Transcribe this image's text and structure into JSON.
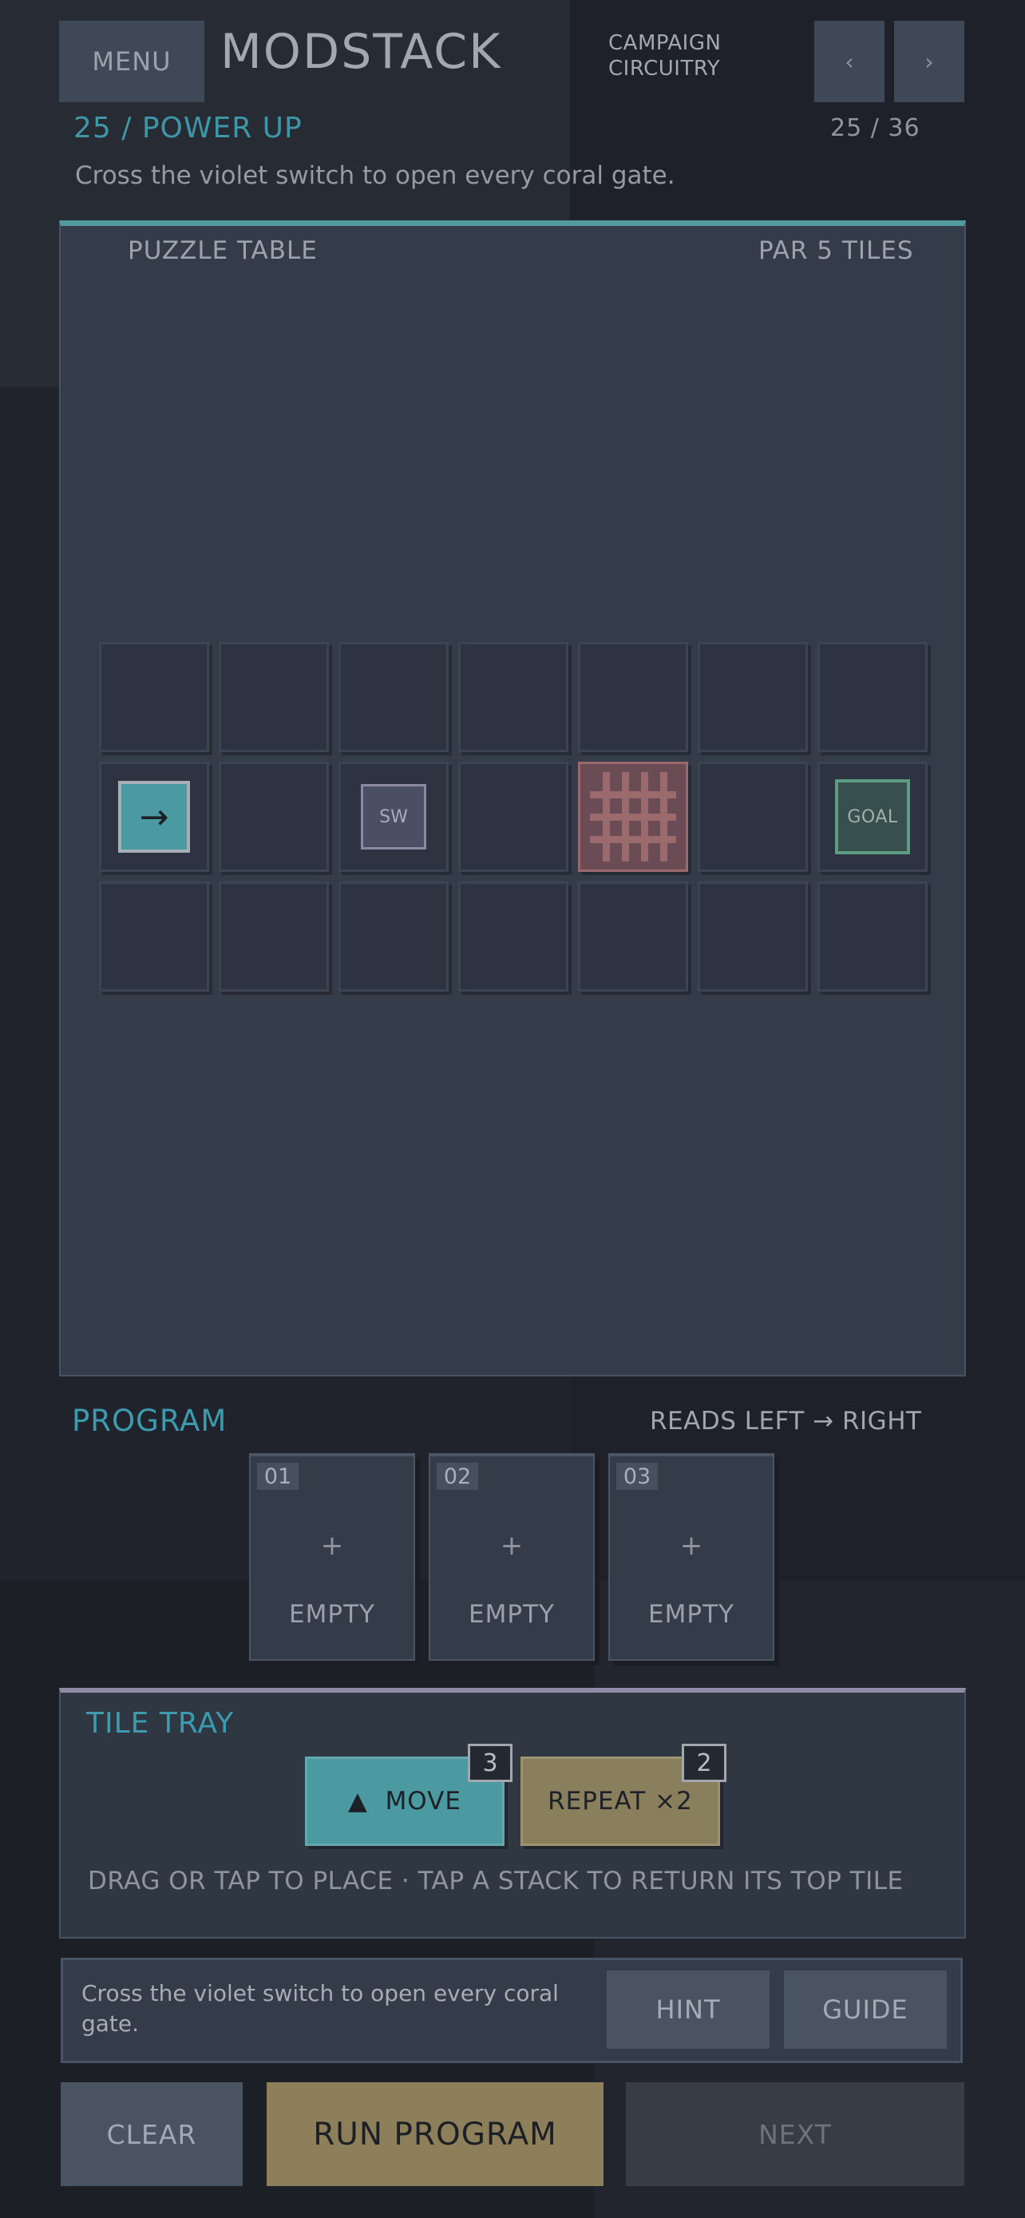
{
  "app": {
    "menu_label": "MENU",
    "title": "MODSTACK",
    "campaign_line1": "CAMPAIGN",
    "campaign_line2": "CIRCUITRY",
    "prev_icon": "chevron-left-icon",
    "next_icon": "chevron-right-icon",
    "prev_glyph": "‹",
    "next_glyph": "›"
  },
  "level": {
    "title": "25 / POWER UP",
    "counter": "25 / 36",
    "objective": "Cross the violet switch to open every coral gate."
  },
  "table": {
    "label": "PUZZLE TABLE",
    "par": "PAR 5 TILES",
    "rows": 3,
    "cols": 7,
    "pieces": {
      "start": {
        "row": 2,
        "col": 1,
        "glyph": "→",
        "icon": "arrow-right-icon"
      },
      "switch": {
        "row": 2,
        "col": 3,
        "label": "SW"
      },
      "gate": {
        "row": 2,
        "col": 5,
        "icon": "gate-icon"
      },
      "goal": {
        "row": 2,
        "col": 7,
        "label": "GOAL"
      }
    }
  },
  "program": {
    "title": "PROGRAM",
    "direction": "READS LEFT → RIGHT",
    "slots": [
      {
        "num": "01",
        "plus": "+",
        "label": "EMPTY"
      },
      {
        "num": "02",
        "plus": "+",
        "label": "EMPTY"
      },
      {
        "num": "03",
        "plus": "+",
        "label": "EMPTY"
      }
    ]
  },
  "tray": {
    "title": "TILE TRAY",
    "tiles": [
      {
        "label": "▲  MOVE",
        "count": "3"
      },
      {
        "label": "REPEAT ×2",
        "count": "2"
      }
    ],
    "help": "DRAG OR TAP TO PLACE · TAP A STACK TO RETURN ITS TOP TILE"
  },
  "hint_bar": {
    "text": "Cross the violet switch to open every coral gate.",
    "hint_label": "HINT",
    "guide_label": "GUIDE"
  },
  "actions": {
    "clear_label": "CLEAR",
    "run_label": "RUN PROGRAM",
    "next_label": "NEXT"
  },
  "colors": {
    "accent_teal": "#3e96a7",
    "move_tile": "#4b9aa1",
    "repeat_tile": "#8a7f5d",
    "switch_violet": "#8c8aa3",
    "gate_coral": "#9a6a6c",
    "goal_green": "#5f9a82"
  }
}
